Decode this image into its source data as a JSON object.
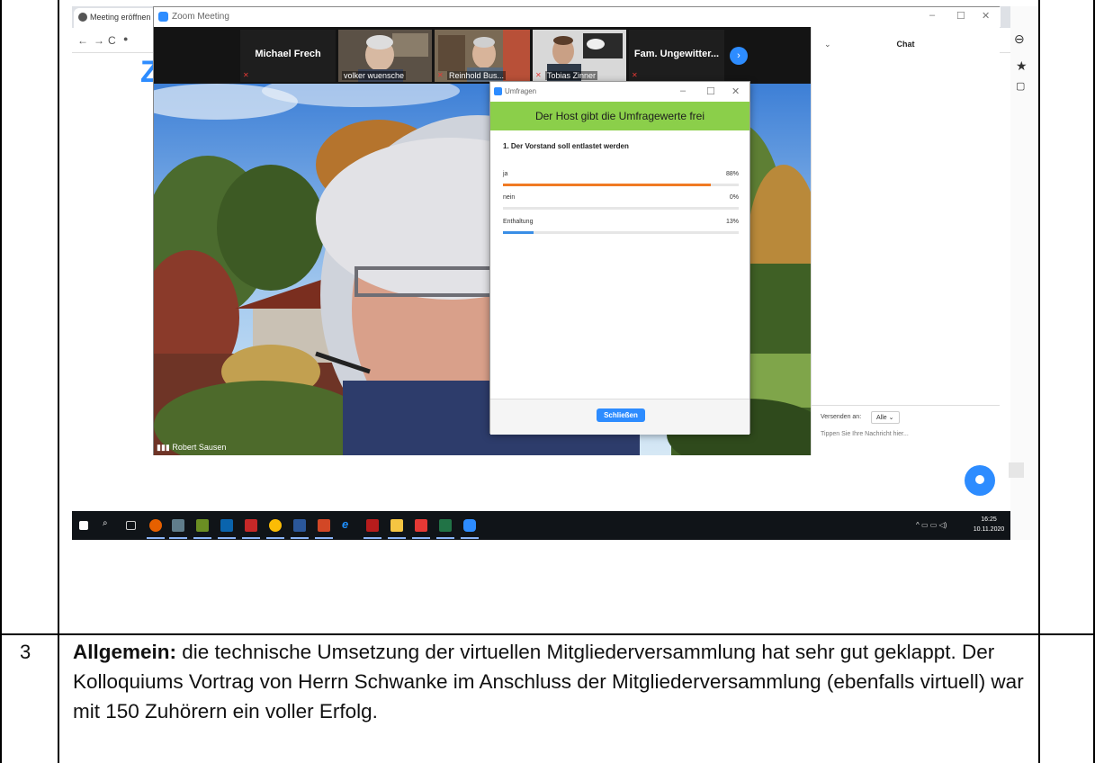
{
  "document": {
    "row_number": "3",
    "text_bold": "Allgemein:",
    "text_body": " die technische Umsetzung der virtuellen Mitgliederversammlung hat sehr gut geklappt. Der Kolloquiums Vortrag von Herrn Schwanke im Anschluss der Mitgliederversammlung (ebenfalls virtuell) war mit 150 Zuhörern ein voller Erfolg."
  },
  "browser": {
    "tab_title": "Meeting eröffnen",
    "logo": "Z"
  },
  "zoom": {
    "window_title": "Zoom Meeting",
    "gallery": [
      {
        "name": "Michael Frech",
        "type": "name-only"
      },
      {
        "name": "volker wuensche",
        "type": "video"
      },
      {
        "name": "Reinhold Bus...",
        "type": "video"
      },
      {
        "name": "Tobias Zinner",
        "type": "video"
      },
      {
        "name": "Fam. Ungewitter...",
        "type": "name-only"
      }
    ],
    "active_speaker": "Robert Sausen"
  },
  "poll": {
    "window_title": "Umfragen",
    "banner": "Der Host gibt die Umfragewerte frei",
    "question": "1. Der Vorstand soll entlastet werden",
    "options": [
      {
        "label": "ja",
        "percent_text": "88%",
        "value": 88,
        "color": "#f07a23"
      },
      {
        "label": "nein",
        "percent_text": "0%",
        "value": 0,
        "color": "#f07a23"
      },
      {
        "label": "Enthaltung",
        "percent_text": "13%",
        "value": 13,
        "color": "#3a8ee6"
      }
    ],
    "close_label": "Schließen"
  },
  "chat": {
    "title": "Chat",
    "send_to_label": "Versenden an:",
    "send_to_value": "Alle",
    "input_placeholder": "Tippen Sie Ihre Nachricht hier..."
  },
  "taskbar": {
    "time": "16:25",
    "date": "10.11.2020"
  },
  "colors": {
    "poll_banner": "#8bcf4a",
    "zoom_blue": "#2d8cff"
  }
}
